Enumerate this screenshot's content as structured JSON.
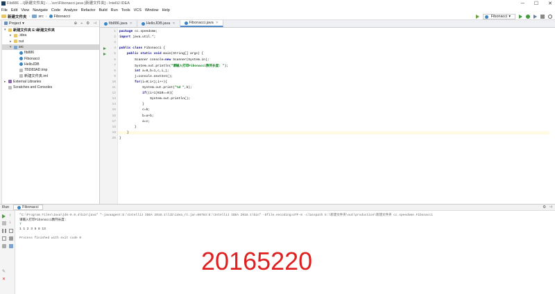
{
  "window": {
    "title": "Fib886 ...\\[新建文件夹] - ...\\src\\Fibonacci.java [新建文件夹] - IntelliJ IDEA",
    "buttons": [
      "─",
      "☐",
      "✕"
    ]
  },
  "menu": [
    "File",
    "Edit",
    "View",
    "Navigate",
    "Code",
    "Analyze",
    "Refactor",
    "Build",
    "Run",
    "Tools",
    "VCS",
    "Window",
    "Help"
  ],
  "nav": {
    "breadcrumbs": [
      "新建文件夹",
      "src",
      "Fibonacci"
    ],
    "run_config": "Fibonacci"
  },
  "project_panel": {
    "header": "Project",
    "tree": [
      {
        "label": "新建文件夹  E:\\新建文件夹",
        "indent": 0,
        "arrow": "▾",
        "icon": "fold",
        "bold": true
      },
      {
        "label": ".idea",
        "indent": 1,
        "arrow": "▸",
        "icon": "fold"
      },
      {
        "label": "out",
        "indent": 1,
        "arrow": "▸",
        "icon": "fold"
      },
      {
        "label": "src",
        "indent": 1,
        "arrow": "▾",
        "icon": "bluefold",
        "selected": true
      },
      {
        "label": "fib886",
        "indent": 2,
        "arrow": "",
        "icon": "java"
      },
      {
        "label": "Fibonacci",
        "indent": 2,
        "arrow": "",
        "icon": "java"
      },
      {
        "label": "HelloJDB",
        "indent": 2,
        "arrow": "",
        "icon": "java"
      },
      {
        "label": "TBD83AD.tmp",
        "indent": 2,
        "arrow": "",
        "icon": "file"
      },
      {
        "label": "新建文件夹.iml",
        "indent": 2,
        "arrow": "",
        "icon": "file"
      },
      {
        "label": "External Libraries",
        "indent": 0,
        "arrow": "▸",
        "icon": "lib"
      },
      {
        "label": "Scratches and Consoles",
        "indent": 0,
        "arrow": "",
        "icon": "file"
      }
    ]
  },
  "editor": {
    "tabs": [
      {
        "label": "fib886.java",
        "active": false
      },
      {
        "label": "HelloJDB.java",
        "active": false
      },
      {
        "label": "Fibonacci.java",
        "active": true
      }
    ],
    "line_numbers": [
      "1",
      "2",
      "3",
      "4",
      "5",
      "6",
      "7",
      "8",
      "9",
      "10",
      "11",
      "12",
      "13",
      "14",
      "15",
      "16",
      "17",
      "18",
      "19",
      "20"
    ],
    "run_markers_lines": [
      4,
      5
    ],
    "current_line": 19,
    "code": [
      [
        {
          "t": "package ",
          "k": "kw"
        },
        {
          "t": "cc.speedome;",
          "k": ""
        }
      ],
      [
        {
          "t": "import ",
          "k": "kw"
        },
        {
          "t": "java.util.*;",
          "k": ""
        }
      ],
      [],
      [
        {
          "t": "public class ",
          "k": "kw"
        },
        {
          "t": "Fibonacci {",
          "k": ""
        }
      ],
      [
        {
          "t": "    public static void ",
          "k": "kw"
        },
        {
          "t": "main(String[] args) {",
          "k": ""
        }
      ],
      [
        {
          "t": "        Scanner console=",
          "k": ""
        },
        {
          "t": "new ",
          "k": "kw"
        },
        {
          "t": "Scanner(System.in);",
          "k": ""
        }
      ],
      [
        {
          "t": "        System.out.println(",
          "k": ""
        },
        {
          "t": "\"请输入打印Fibonacci数列长度: \"",
          "k": "str"
        },
        {
          "t": ");",
          "k": ""
        }
      ],
      [
        {
          "t": "        int ",
          "k": "kw"
        },
        {
          "t": "a=0,b=1,c,i,j;",
          "k": ""
        }
      ],
      [
        {
          "t": "        j=console.nextInt();",
          "k": ""
        }
      ],
      [
        {
          "t": "        for",
          "k": "kw"
        },
        {
          "t": "(i=0;i<j;i++){",
          "k": ""
        }
      ],
      [
        {
          "t": "            System.out.print(",
          "k": ""
        },
        {
          "t": "\"%d \"",
          "k": "str"
        },
        {
          "t": ",b);",
          "k": ""
        }
      ],
      [
        {
          "t": "            if",
          "k": "kw"
        },
        {
          "t": "((i+1)%10==0){",
          "k": ""
        }
      ],
      [
        {
          "t": "                System.out.println();",
          "k": ""
        }
      ],
      [
        {
          "t": "            }",
          "k": ""
        }
      ],
      [
        {
          "t": "            c=b;",
          "k": ""
        }
      ],
      [
        {
          "t": "            b=a+b;",
          "k": ""
        }
      ],
      [
        {
          "t": "            a=c;",
          "k": ""
        }
      ],
      [
        {
          "t": "        }",
          "k": ""
        }
      ],
      [
        {
          "t": "    }",
          "k": ""
        }
      ],
      [
        {
          "t": "}",
          "k": ""
        }
      ]
    ]
  },
  "run_panel": {
    "label": "Run",
    "tab": "Fibonacci",
    "console": [
      {
        "text": "\"C:\\Program Files\\Java\\jdk-9.0.4\\bin\\java\" \"-javaagent:E:\\IntelliJ IDEA 2018.1\\lib\\idea_rt.jar=60783:E:\\IntelliJ IDEA 2018.1\\bin\" -Dfile.encoding=UTF-8 -classpath E:\\新建文件夹\\out\\production\\新建文件夹 cc.speedome.Fibonacci",
        "cls": "gray"
      },
      {
        "text": "请输入打印Fibonacci数列长度:",
        "cls": ""
      },
      {
        "text": "7",
        "cls": "grn"
      },
      {
        "text": "1 1 2 3 5 8 13",
        "cls": ""
      },
      {
        "text": "",
        "cls": ""
      },
      {
        "text": "Process finished with exit code 0",
        "cls": "gray"
      }
    ]
  },
  "overlay_number": "20165220",
  "colors": {
    "overlay": "#e02020",
    "run_green": "#3f9b3c",
    "keyword": "#000080",
    "string": "#067d17"
  }
}
